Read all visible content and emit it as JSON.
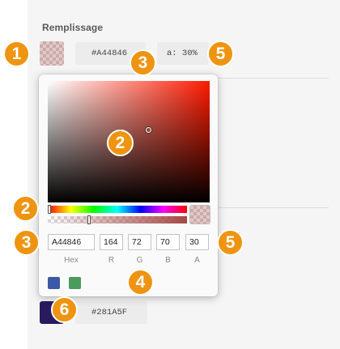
{
  "fill": {
    "title": "Remplissage",
    "hex_value": "#A44846",
    "alpha_value": "a: 30%",
    "color": "#A44846",
    "alpha": 0.3
  },
  "picker": {
    "hue_color": "#FF1A00",
    "hue_position": 0.01,
    "alpha_position": 0.3,
    "inputs": {
      "hex": "A44846",
      "r": "164",
      "g": "72",
      "b": "70",
      "a": "30"
    },
    "labels": {
      "hex": "Hex",
      "r": "R",
      "g": "G",
      "b": "B",
      "a": "A"
    },
    "presets": [
      {
        "color": "#3A5AA8"
      },
      {
        "color": "#4C9A5E"
      }
    ]
  },
  "second_fill": {
    "hex_value": "#281A5F",
    "color": "#281A5F"
  },
  "callouts": {
    "c1": "1",
    "c2a": "2",
    "c2b": "2",
    "c3a": "3",
    "c3b": "3",
    "c4": "4",
    "c5a": "5",
    "c5b": "5",
    "c6": "6"
  },
  "colors": {
    "callout": "#EF9410",
    "panel": "#F5F5F5"
  }
}
